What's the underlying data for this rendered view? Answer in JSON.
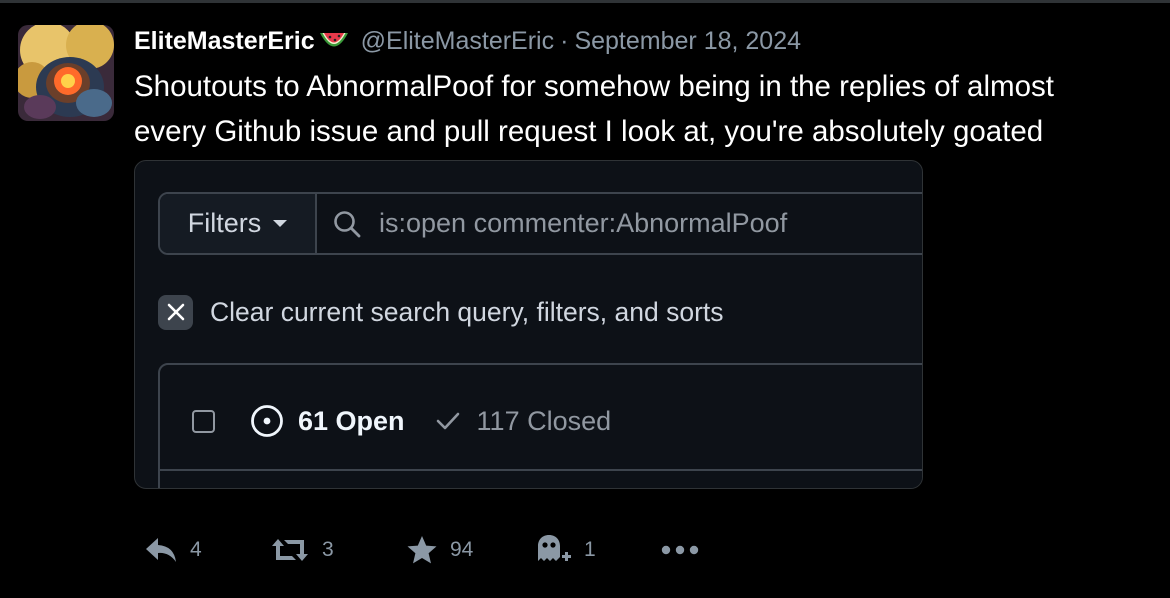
{
  "post": {
    "display_name": "EliteMasterEric",
    "emoji": "watermelon-icon",
    "handle": "@EliteMasterEric",
    "separator": "·",
    "date": "September 18, 2024",
    "text_line1": "Shoutouts to AbnormalPoof for somehow being in the replies of almost",
    "text_line2": "every Github issue and pull request I look at, you're absolutely goated"
  },
  "embed": {
    "filters_label": "Filters",
    "search_query": "is:open commenter:AbnormalPoof",
    "clear_label": "Clear current search query, filters, and sorts",
    "open_count": "61 Open",
    "closed_count": "117 Closed"
  },
  "actions": {
    "reply_count": "4",
    "repost_count": "3",
    "like_count": "94",
    "quote_count": "1"
  },
  "colors": {
    "background": "#000000",
    "text_primary": "#ffffff",
    "text_muted": "#8b98a5",
    "embed_bg": "#0d1117",
    "embed_border": "#3d444d"
  }
}
